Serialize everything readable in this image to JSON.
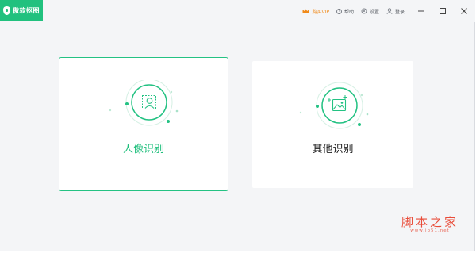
{
  "app": {
    "logo_text": "傲软抠图"
  },
  "titlebar": {
    "buy_vip_label": "购买VIP",
    "help_label": "帮助",
    "settings_label": "设置",
    "login_label": "登录"
  },
  "cards": {
    "portrait": {
      "label": "人像识别",
      "icon": "portrait-scan-icon",
      "selected": true
    },
    "other": {
      "label": "其他识别",
      "icon": "image-scan-icon",
      "selected": false
    }
  },
  "watermark": {
    "main": "脚本之家",
    "sub": "www.jb51.net"
  },
  "colors": {
    "accent": "#21c17e",
    "vip": "#f08a1a",
    "watermark": "#e94c39"
  }
}
